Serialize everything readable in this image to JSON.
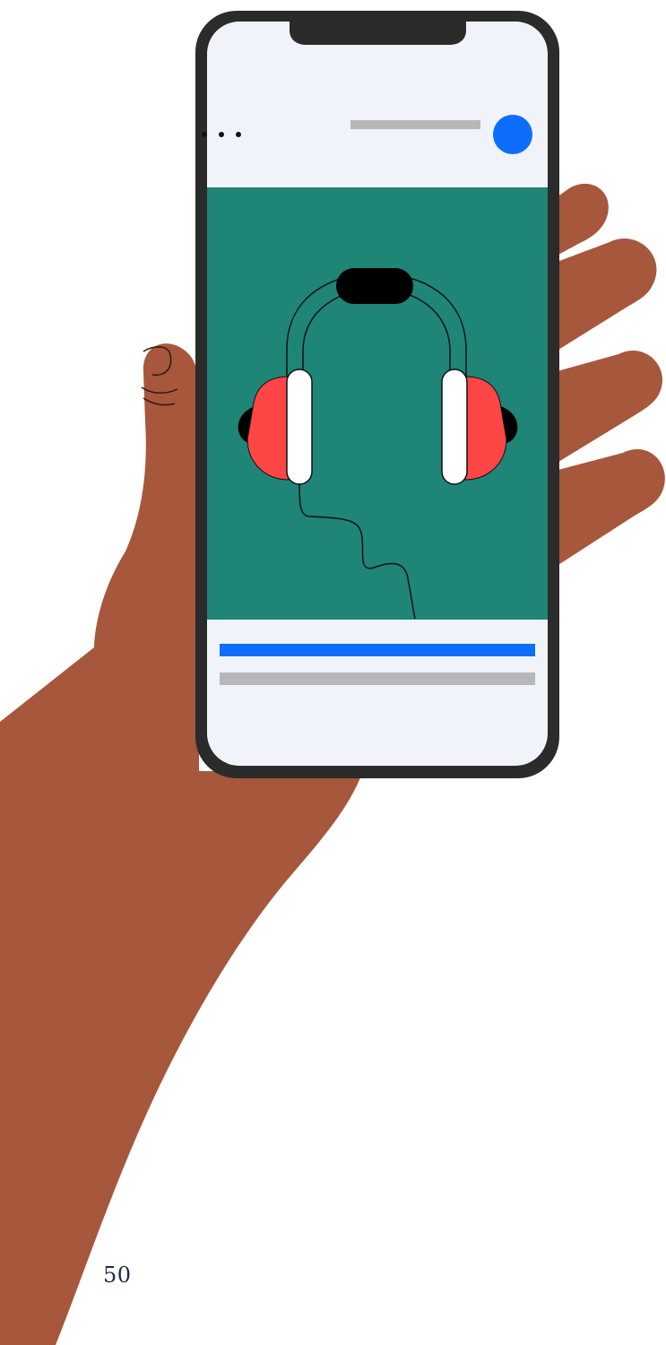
{
  "page": {
    "number": "50"
  },
  "colors": {
    "skin": "#a6573c",
    "phone_frame": "#2b2b2b",
    "screen_bg": "#f0f4fa",
    "media_bg": "#1f8576",
    "accent_blue": "#0d6efd",
    "placeholder_gray": "#b7b7b9",
    "earcup_red": "#ff4646"
  },
  "icons": {
    "menu": "more-dots-icon",
    "avatar": "profile-avatar-icon",
    "media": "headphones-icon"
  }
}
